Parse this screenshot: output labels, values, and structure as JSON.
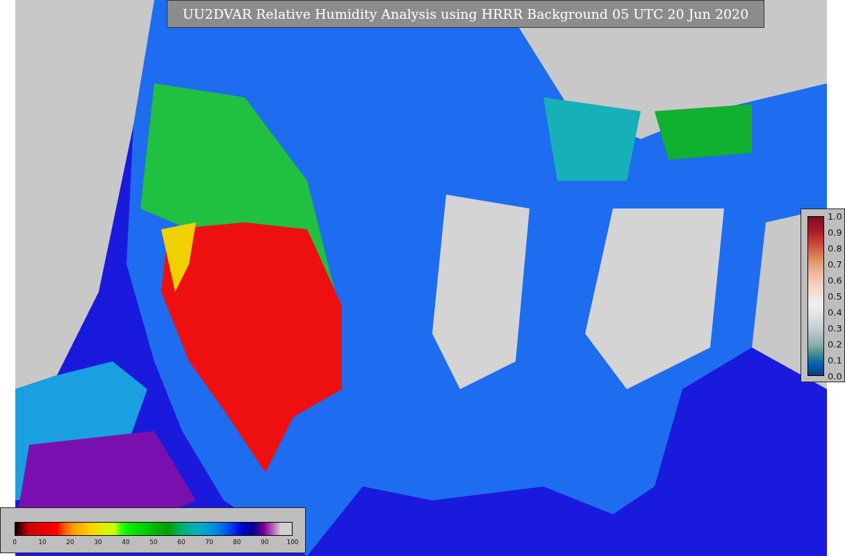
{
  "title": "UU2DVAR Relative Humidity Analysis using HRRR Background 05 UTC 20 Jun 2020",
  "vertical_colorbar": {
    "ticks": [
      "1.0",
      "0.9",
      "0.8",
      "0.7",
      "0.6",
      "0.5",
      "0.4",
      "0.3",
      "0.2",
      "0.1",
      "0.0"
    ]
  },
  "horizontal_colorbar": {
    "ticks": [
      "0",
      "10",
      "20",
      "30",
      "40",
      "50",
      "60",
      "70",
      "80",
      "90",
      "100"
    ]
  }
}
